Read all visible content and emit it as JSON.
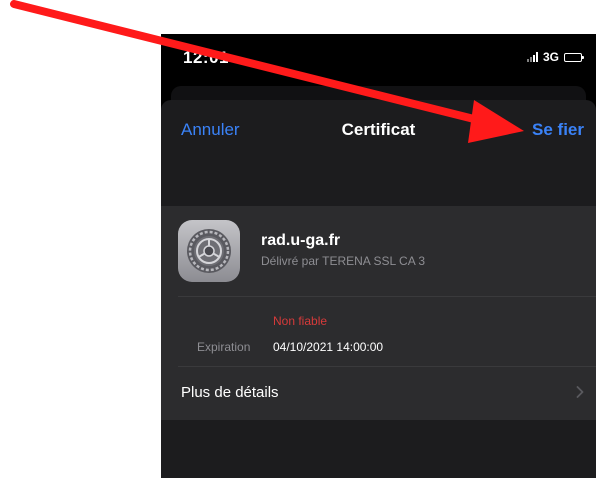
{
  "status_bar": {
    "time": "12:01",
    "network": "3G"
  },
  "nav": {
    "cancel_label": "Annuler",
    "title": "Certificat",
    "trust_label": "Se fier"
  },
  "certificate": {
    "name": "rad.u-ga.fr",
    "issuer": "Délivré par TERENA SSL CA 3",
    "trust_status": "Non fiable",
    "expiration_label": "Expiration",
    "expiration_value": "04/10/2021 14:00:00",
    "details_label": "Plus de détails"
  },
  "icons": {
    "certificate": "settings-gear-icon",
    "details": "chevron-right-icon",
    "annotation": "red-arrow-icon"
  },
  "colors": {
    "accent": "#3a82f7",
    "warning": "#d63a3a",
    "annotation": "#ff1a1a"
  }
}
